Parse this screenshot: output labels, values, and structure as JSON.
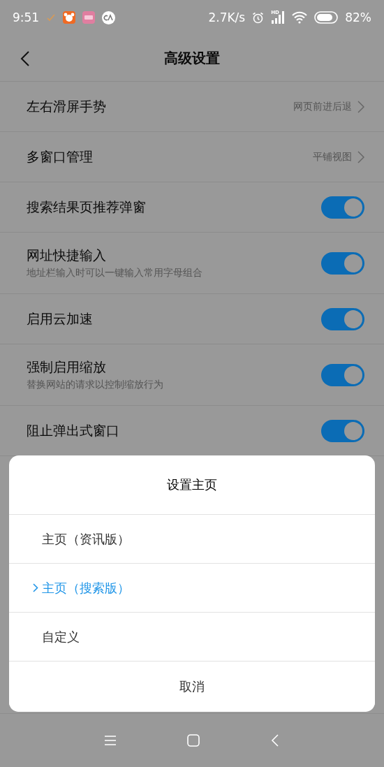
{
  "status_bar": {
    "time": "9:51",
    "speed": "2.7K/s",
    "hd_label": "HD",
    "battery": "82%"
  },
  "header": {
    "title": "高级设置"
  },
  "settings": [
    {
      "kind": "link",
      "label": "左右滑屏手势",
      "value": "网页前进后退"
    },
    {
      "kind": "link",
      "label": "多窗口管理",
      "value": "平铺视图"
    },
    {
      "kind": "toggle",
      "label": "搜索结果页推荐弹窗",
      "on": true
    },
    {
      "kind": "toggle",
      "label": "网址快捷输入",
      "subtitle": "地址栏输入时可以一键输入常用字母组合",
      "on": true
    },
    {
      "kind": "toggle",
      "label": "启用云加速",
      "on": true
    },
    {
      "kind": "toggle",
      "label": "强制启用缩放",
      "subtitle": "替换网站的请求以控制缩放行为",
      "on": true
    },
    {
      "kind": "toggle",
      "label": "阻止弹出式窗口",
      "on": true
    }
  ],
  "dialog": {
    "title": "设置主页",
    "options": [
      {
        "label": "主页（资讯版）",
        "selected": false
      },
      {
        "label": "主页（搜索版）",
        "selected": true
      },
      {
        "label": "自定义",
        "selected": false
      }
    ],
    "cancel": "取消"
  }
}
